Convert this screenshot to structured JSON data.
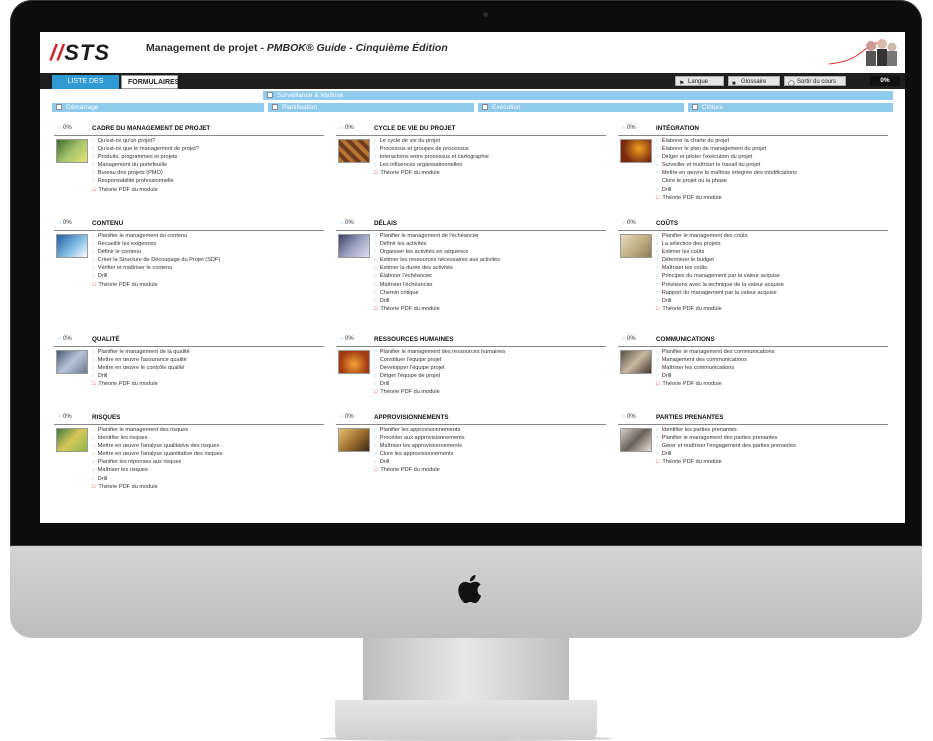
{
  "app": {
    "logo": "STS",
    "title_main": "Management de projet - ",
    "title_italic": "PMBOK® Guide - Cinquième Édition"
  },
  "nav": {
    "tab_lessons": "LISTE DES LEÇONS",
    "tab_forms": "FORMULAIRES",
    "btn_language": "Langue",
    "btn_glossary": "Glossaire",
    "btn_exit": "Sortir du cours",
    "progress": "0%"
  },
  "phases": {
    "demarrage": "Démarrage",
    "surveillance": "Surveillance & Maîtrise",
    "planification": "Planification",
    "execution": "Exécution",
    "cloture": "Clôture"
  },
  "modules": [
    {
      "pct": "0%",
      "title": "CADRE DU MANAGEMENT DE PROJET",
      "items": [
        "Qu'est-ce qu'un projet?",
        "Qu'est-ce que le management de projet?",
        "Produits, programmes et projets",
        "Management du portefeuille",
        "Bureau des projets (PMO)",
        "Responsabilité professionnelle"
      ],
      "pdf": "Théorie PDF du module"
    },
    {
      "pct": "0%",
      "title": "CYCLE DE VIE DU PROJET",
      "items": [
        "Le cycle de vie du projet",
        "Processus et groupes de processus",
        "Interactions entre processus et cartographie",
        "Les influences organisationnelles"
      ],
      "pdf": "Théorie PDF du module"
    },
    {
      "pct": "0%",
      "title": "INTÉGRATION",
      "items": [
        "Élaborer la charte du projet",
        "Élaborer le plan de management du projet",
        "Diriger et piloter l'exécution du projet",
        "Surveiller et maîtriser le travail du projet",
        "Mettre en œuvre la maîtrise intégrée des modifications",
        "Clore le projet ou la phase",
        "Drill"
      ],
      "pdf": "Théorie PDF du module"
    },
    {
      "pct": "0%",
      "title": "CONTENU",
      "items": [
        "Planifier le management du contenu",
        "Recueillir les exigences",
        "Définir le contenu",
        "Créer la Structure de Découpage du Projet (SDP)",
        "Vérifier et maîtriser le contenu",
        "Drill"
      ],
      "pdf": "Théorie PDF du module"
    },
    {
      "pct": "0%",
      "title": "DÉLAIS",
      "items": [
        "Planifier le management de l'échéancier",
        "Définir les activités",
        "Organiser les activités en séquence",
        "Estimer les ressources nécessaires aux activités",
        "Estimer la durée des activités",
        "Élaborer l'échéancier",
        "Maîtriser l'échéancier",
        "Chemin critique",
        "Drill"
      ],
      "pdf": "Théorie PDF du module"
    },
    {
      "pct": "0%",
      "title": "COÛTS",
      "items": [
        "Planifier le management des coûts",
        "La sélection des projets",
        "Estimer les coûts",
        "Déterminer le budget",
        "Maîtriser les coûts",
        "Principes du management par la valeur acquise",
        "Prévisions avec la technique de la valeur acquise",
        "Rapport du management par la valeur acquise",
        "Drill"
      ],
      "pdf": "Théorie PDF du module"
    },
    {
      "pct": "0%",
      "title": "QUALITÉ",
      "items": [
        "Planifier le management de la qualité",
        "Mettre en œuvre l'assurance qualité",
        "Mettre en œuvre le contrôle qualité",
        "Drill"
      ],
      "pdf": "Théorie PDF du module"
    },
    {
      "pct": "0%",
      "title": "RESSOURCES HUMAINES",
      "items": [
        "Planifier le management des ressources humaines",
        "Constituer l'équipe projet",
        "Développer l'équipe projet",
        "Diriger l'équipe de projet",
        "Drill"
      ],
      "pdf": "Théorie PDF du module"
    },
    {
      "pct": "0%",
      "title": "COMMUNICATIONS",
      "items": [
        "Planifier le management des communications",
        "Management des communications",
        "Maîtriser les communications",
        "Drill"
      ],
      "pdf": "Théorie PDF du module"
    },
    {
      "pct": "0%",
      "title": "RISQUES",
      "items": [
        "Planifier le management des risques",
        "Identifier les risques",
        "Mettre en œuvre l'analyse qualitative des risques",
        "Mettre en œuvre l'analyse quantitative des risques",
        "Planifier les réponses aux risques",
        "Maîtriser les risques",
        "Drill"
      ],
      "pdf": "Théorie PDF du module"
    },
    {
      "pct": "0%",
      "title": "APPROVISIONNEMENTS",
      "items": [
        "Planifier les approvisionnements",
        "Procéder aux approvisionnements",
        "Maîtriser les approvisionnements",
        "Clore les approvisionnements",
        "Drill"
      ],
      "pdf": "Théorie PDF du module"
    },
    {
      "pct": "0%",
      "title": "PARTIES PRENANTES",
      "items": [
        "Identifier les parties prenantes",
        "Planifier le management des parties prenantes",
        "Gérer et maîtriser l'engagement des parties prenantes",
        "Drill"
      ],
      "pdf": "Théorie PDF du module"
    }
  ],
  "colors": {
    "accent": "#2f9ad3",
    "phase": "#8fcbec",
    "pdf": "#d0202a",
    "bezel": "#0d0d0d"
  }
}
